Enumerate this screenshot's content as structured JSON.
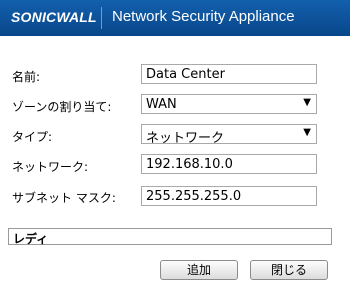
{
  "header": {
    "logo_text": "SONICWALL",
    "title": "Network Security Appliance"
  },
  "form": {
    "name": {
      "label": "名前:",
      "value": "Data Center"
    },
    "zone": {
      "label": "ゾーンの割り当て:",
      "value": "WAN"
    },
    "type": {
      "label": "タイプ:",
      "value": "ネットワーク"
    },
    "network": {
      "label": "ネットワーク:",
      "value": "192.168.10.0"
    },
    "subnet": {
      "label": "サブネット マスク:",
      "value": "255.255.255.0"
    }
  },
  "status": {
    "text": "レディ"
  },
  "buttons": {
    "add": "追加",
    "close": "閉じる"
  },
  "colors": {
    "header_bg": "#0b4f96"
  }
}
